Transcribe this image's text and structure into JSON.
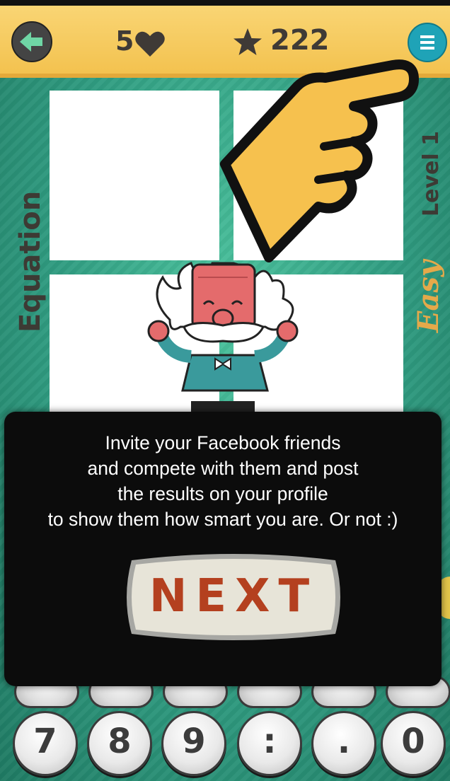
{
  "header": {
    "back_icon": "arrow-left-icon",
    "lives": "5",
    "lives_icon": "heart-icon",
    "score_icon": "star-icon",
    "score": "222",
    "menu_icon": "menu-icon"
  },
  "puzzle": {
    "left_label": "Equation",
    "level_label": "Level 1",
    "difficulty_label": "Easy"
  },
  "tutorial": {
    "message_lines": [
      "Invite your Facebook friends",
      "and compete with them and post",
      "the results on your profile",
      "to show them how smart you are. Or not  :)"
    ],
    "next_label": "NEXT",
    "pointer_icon": "pointing-hand-icon"
  },
  "keypad": {
    "keys": [
      "7",
      "8",
      "9",
      ":",
      ".",
      "0"
    ]
  },
  "colors": {
    "accent": "#f3c24f",
    "background": "#2f9b80",
    "menu": "#1fa3b7",
    "next_text": "#b4401f"
  }
}
